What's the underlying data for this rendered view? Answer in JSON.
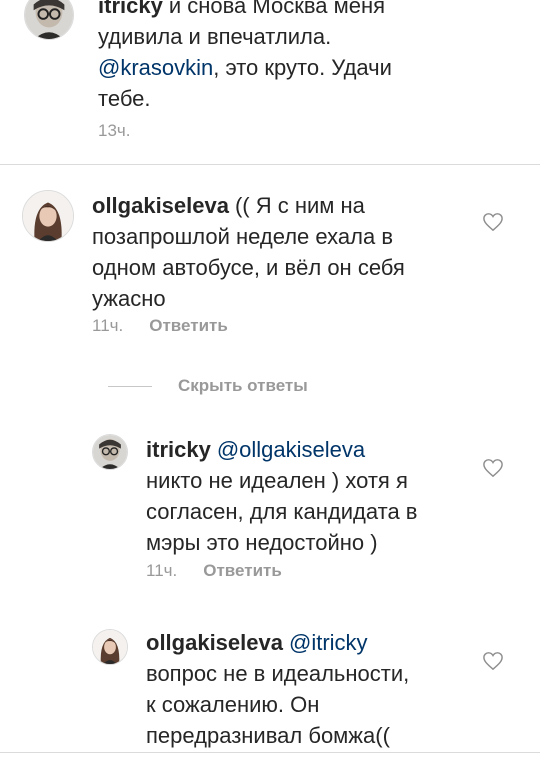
{
  "comments": [
    {
      "username": "itricky",
      "text": "и снова Москва меня\nудивила и впечатлила.\n",
      "mention": "@krasovkin",
      "text_after": ", это круто. Удачи\nтебе.",
      "time": "13ч."
    },
    {
      "username": "ollgakiseleva",
      "text": "(( Я с ним на\nпозапрошлой неделе ехала в\nодном автобусе, и вёл он себя\nужасно",
      "time": "11ч.",
      "reply_label": "Ответить"
    }
  ],
  "hide_replies_label": "Скрыть ответы",
  "replies": [
    {
      "username": "itricky",
      "mention": "@ollgakiseleva",
      "text": "никто не идеален ) хотя я\nсогласен, для кандидата в\nмэры это недостойно )",
      "time": "11ч.",
      "reply_label": "Ответить"
    },
    {
      "username": "ollgakiseleva",
      "mention": "@itricky",
      "text": "вопрос не в идеальности,\nк сожалению. Он\nпередразнивал бомжа((",
      "time": "",
      "reply_label": ""
    }
  ]
}
